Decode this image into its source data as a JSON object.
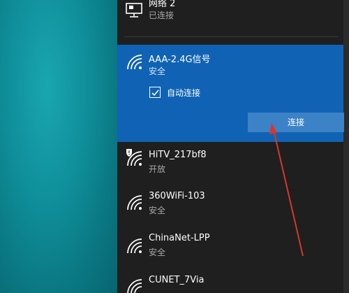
{
  "networks": [
    {
      "name": "网络 2",
      "status": "已连接",
      "icon": "wired-network-icon"
    },
    {
      "name": "AAA-2.4G信号",
      "status": "安全",
      "icon": "wifi-icon",
      "selected": true,
      "auto_connect_label": "自动连接",
      "auto_connect_checked": true,
      "connect_label": "连接"
    },
    {
      "name": "HiTV_217bf8",
      "status": "开放",
      "icon": "wifi-warning-icon"
    },
    {
      "name": "360WiFi-103",
      "status": "安全",
      "icon": "wifi-icon"
    },
    {
      "name": "ChinaNet-LPP",
      "status": "安全",
      "icon": "wifi-icon"
    },
    {
      "name": "CUNET_7Via",
      "status": "",
      "icon": "wifi-icon"
    }
  ],
  "colors": {
    "panel_bg": "#1f1f1f",
    "selected_bg": "#1063b4",
    "button_bg": "#3c82c6",
    "annotation_arrow": "#d9362b"
  }
}
